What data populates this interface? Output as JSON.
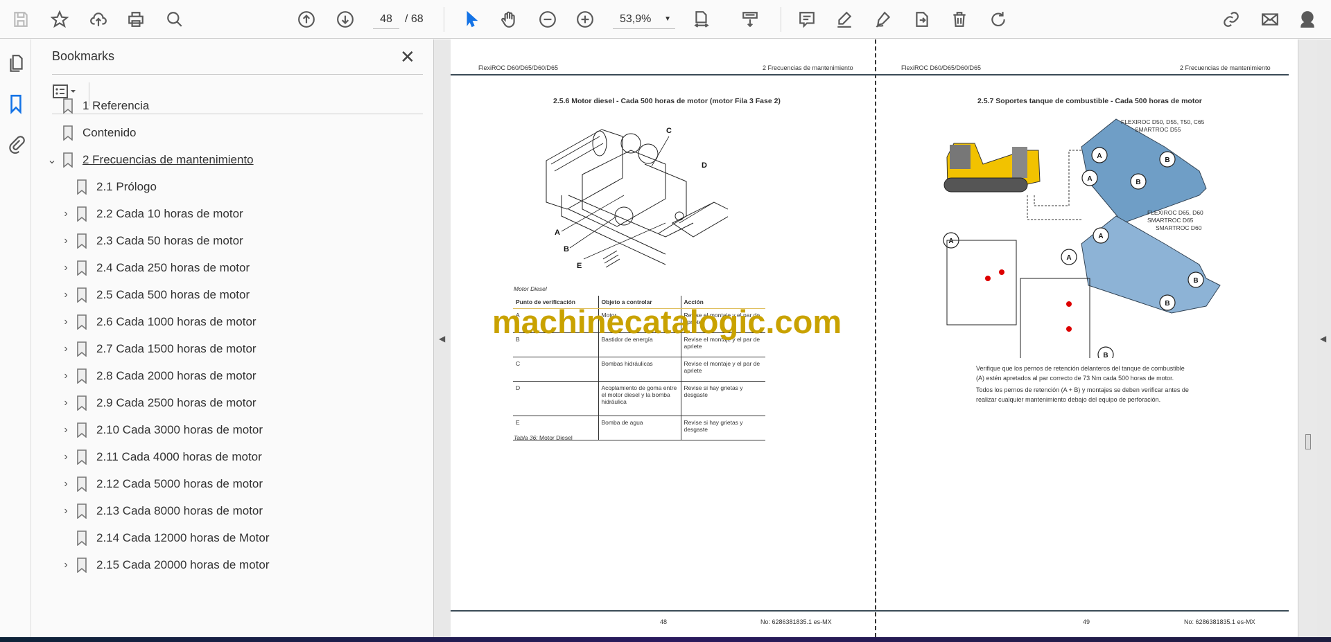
{
  "toolbar": {
    "page_current": "48",
    "page_total": "/ 68",
    "zoom": "53,9%",
    "icons": [
      "save-icon",
      "star-icon",
      "upload-icon",
      "print-icon",
      "find-icon",
      "prev-page-icon",
      "next-page-icon",
      "select-icon",
      "hand-icon",
      "zoom-out-icon",
      "zoom-in-icon",
      "fit-page-icon",
      "scroll-mode-icon",
      "comment-icon",
      "highlight-icon",
      "sign-icon",
      "export-icon",
      "delete-icon",
      "rotate-icon",
      "share-link-icon",
      "email-icon",
      "account-icon"
    ]
  },
  "bookmarks": {
    "title": "Bookmarks",
    "items": [
      {
        "label": "1 Referencia",
        "level": 0,
        "expander": ""
      },
      {
        "label": "Contenido",
        "level": 0,
        "expander": ""
      },
      {
        "label": "2 Frecuencias de mantenimiento",
        "level": 0,
        "expander": "open"
      },
      {
        "label": "2.1 Prólogo",
        "level": 1,
        "expander": ""
      },
      {
        "label": "2.2 Cada 10 horas de motor",
        "level": 1,
        "expander": "closed"
      },
      {
        "label": "2.3 Cada 50 horas de motor",
        "level": 1,
        "expander": "closed"
      },
      {
        "label": "2.4 Cada 250 horas de motor",
        "level": 1,
        "expander": "closed"
      },
      {
        "label": "2.5 Cada 500 horas de motor",
        "level": 1,
        "expander": "closed"
      },
      {
        "label": "2.6 Cada 1000 horas de motor",
        "level": 1,
        "expander": "closed"
      },
      {
        "label": "2.7 Cada 1500 horas de motor",
        "level": 1,
        "expander": "closed"
      },
      {
        "label": "2.8 Cada 2000 horas de motor",
        "level": 1,
        "expander": "closed"
      },
      {
        "label": "2.9 Cada 2500 horas de motor",
        "level": 1,
        "expander": "closed"
      },
      {
        "label": "2.10 Cada 3000 horas de motor",
        "level": 1,
        "expander": "closed"
      },
      {
        "label": "2.11 Cada 4000 horas de motor",
        "level": 1,
        "expander": "closed"
      },
      {
        "label": "2.12 Cada 5000 horas de motor",
        "level": 1,
        "expander": "closed"
      },
      {
        "label": "2.13 Cada 8000 horas de motor",
        "level": 1,
        "expander": "closed"
      },
      {
        "label": "2.14 Cada 12000 horas de Motor",
        "level": 1,
        "expander": ""
      },
      {
        "label": "2.15 Cada 20000 horas de motor",
        "level": 1,
        "expander": "closed"
      }
    ]
  },
  "left_page": {
    "header_left": "FlexiROC D60/D65/D60/D65",
    "header_right": "2 Frecuencias de mantenimiento",
    "title": "2.5.6 Motor diesel - Cada 500 horas de motor (motor Fila 3 Fase 2)",
    "figure_labels": [
      "A",
      "B",
      "C",
      "D",
      "E"
    ],
    "caption_top": "Motor Diesel",
    "table": {
      "headers": [
        "Punto de verificación",
        "Objeto a controlar",
        "Acción"
      ],
      "rows": [
        [
          "A",
          "Motor",
          "Revise el montaje y el par de apriete"
        ],
        [
          "B",
          "Bastidor de energía",
          "Revise el montaje y el par de apriete"
        ],
        [
          "C",
          "Bombas hidráulicas",
          "Revise el montaje y el par de apriete"
        ],
        [
          "D",
          "Acoplamiento de goma entre el motor diesel y la bomba hidráulica",
          "Revise si hay grietas y desgaste"
        ],
        [
          "E",
          "Bomba de agua",
          "Revise si hay grietas y desgaste"
        ]
      ]
    },
    "caption_prefix": "Tabla 36:",
    "caption": " Motor Diesel",
    "page_number": "48",
    "doc_number": "No: 6286381835.1 es-MX"
  },
  "right_page": {
    "header_left": "FlexiROC D60/D65/D60/D65",
    "header_right": "2 Frecuencias de mantenimiento",
    "title": "2.5.7 Soportes tanque de combustible - Cada 500 horas de motor",
    "model_top_1": "FLEXIROC D50, D55, T50, C65",
    "model_top_2": "SMARTROC D55",
    "model_bot_1": "FLEXIROC D65, D60",
    "model_bot_2": "SMARTROC D65",
    "model_bot_3": "SMARTROC D60",
    "para1": "Verifique que los pernos de retención delanteros del tanque de combustible (A) estén apretados al par correcto de 73 Nm cada 500 horas de motor.",
    "para2": "Todos los pernos de retención (A + B) y montajes se deben verificar antes de realizar cualquier mantenimiento debajo del equipo de perforación.",
    "page_number": "49",
    "doc_number": "No: 6286381835.1 es-MX"
  },
  "watermark": "machinecatalogic.com",
  "colors": {
    "accent": "#1473e6",
    "watermark": "#c9a200",
    "tank": "#7fa8cc",
    "machine": "#f2c200"
  }
}
